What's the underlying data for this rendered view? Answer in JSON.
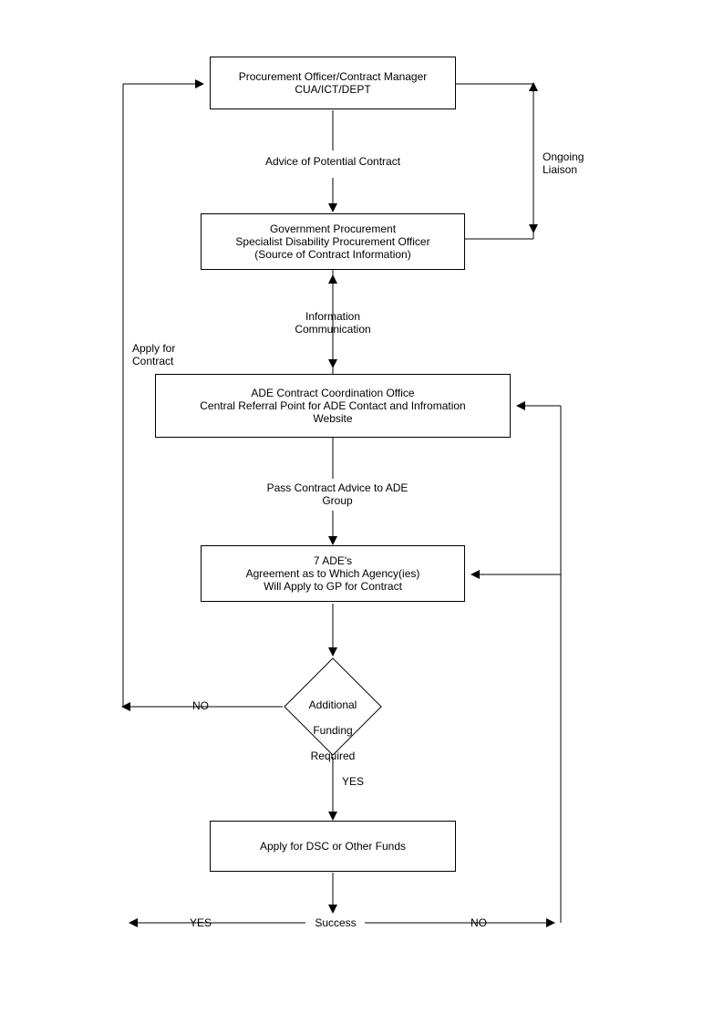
{
  "box1": {
    "line1": "Procurement Officer/Contract Manager",
    "line2": "CUA/ICT/DEPT"
  },
  "box2": {
    "line1": "Government Procurement",
    "line2": "Specialist Disability Procurement Officer",
    "line3": "(Source of Contract Information)"
  },
  "box3": {
    "line1": "ADE Contract Coordination Office",
    "line2": "Central Referral Point for ADE Contact and Infromation",
    "line3": "Website"
  },
  "box4": {
    "line1": "7 ADE's",
    "line2": "Agreement as to Which Agency(ies)",
    "line3": "Will Apply to GP for Contract"
  },
  "box5": {
    "line1": "Apply for DSC or Other Funds"
  },
  "decision": {
    "line1": "Additional",
    "line2": "Funding",
    "line3": "Required"
  },
  "labels": {
    "advice": "Advice of Potential Contract",
    "ongoing": "Ongoing\nLiaison",
    "apply_for_contract": "Apply for\nContract",
    "information": "Information\nCommunication",
    "pass_contract": "Pass Contract Advice to ADE\nGroup",
    "no": "NO",
    "yes": "YES",
    "success": "Success",
    "yes2": "YES",
    "no2": "NO"
  }
}
